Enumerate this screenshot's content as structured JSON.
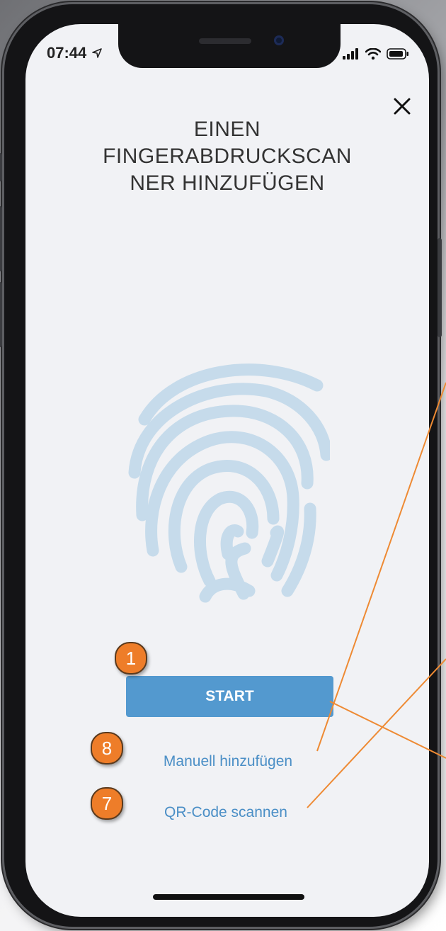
{
  "status_bar": {
    "time": "07:44"
  },
  "screen": {
    "title_lines": [
      "EINEN",
      "FINGERABDRUCKSCAN",
      "NER HINZUFÜGEN"
    ],
    "start_label": "START",
    "manual_label": "Manuell hinzufügen",
    "qr_label": "QR-Code scannen"
  },
  "badges": {
    "start": "1",
    "manual": "8",
    "qr": "7"
  },
  "colors": {
    "accent": "#5399cf",
    "link": "#4b8fc6",
    "fingerprint": "#c6dbeb",
    "badge": "#ee7d29",
    "leader_line": "#ee8a33"
  },
  "icons": [
    "location-arrow-icon",
    "cellular-signal-icon",
    "wifi-icon",
    "battery-icon",
    "close-icon",
    "fingerprint-icon"
  ]
}
